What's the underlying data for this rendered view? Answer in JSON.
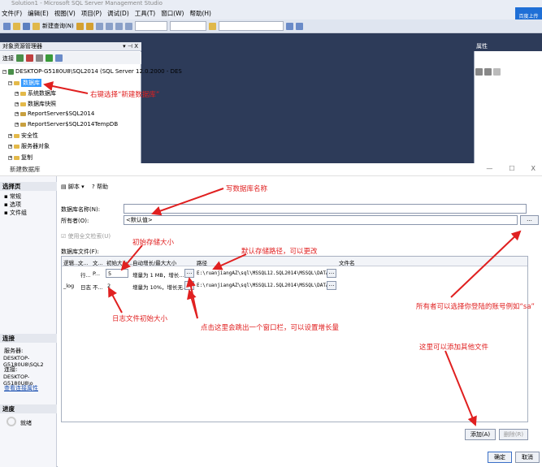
{
  "window": {
    "title": "Solution1 - Microsoft SQL Server Management Studio"
  },
  "menu": [
    "文件(F)",
    "编辑(E)",
    "视图(V)",
    "项目(P)",
    "调试(D)",
    "工具(T)",
    "窗口(W)",
    "帮助(H)"
  ],
  "toolbar": {
    "new_query": "新建查询(N)"
  },
  "cloud_button": "百度上传",
  "object_explorer": {
    "title": "对象资源管理器",
    "pin": "▾ ⊣ X",
    "connect": "连接",
    "server": "DESKTOP-G5180U8\\SQL2014 (SQL Server 12.0.2000 - DES",
    "databases": "数据库",
    "children": [
      "系统数据库",
      "数据库快照",
      "ReportServer$SQL2014",
      "ReportServer$SQL2014TempDB"
    ],
    "siblings": [
      "安全性",
      "服务器对象",
      "复制"
    ]
  },
  "properties_panel": {
    "title": "属性"
  },
  "dialog": {
    "title": "新建数据库",
    "minimize": "—",
    "maximize": "☐",
    "close": "X",
    "select_page_header": "选择页",
    "pages": [
      "常规",
      "选项",
      "文件组"
    ],
    "toolbar_script": "脚本 ▾",
    "toolbar_help": "帮助",
    "db_name_label": "数据库名称(N):",
    "db_name_value": "",
    "owner_label": "所有者(O):",
    "owner_value": "<默认值>",
    "owner_browse": "...",
    "fulltext_label": "使用全文检索(U)",
    "files_label": "数据库文件(F):",
    "columns": [
      "逻辑...",
      "文...",
      "文...",
      "初始大小...",
      "自动增长/最大大小",
      "路径",
      "文件名"
    ],
    "rows": [
      {
        "logical": "",
        "type": "行...",
        "filegroup": "P...",
        "size": "5",
        "growth": "增量为 1 MB，增长...",
        "path": "E:\\ruanjiangAZ\\sql\\MSSQL12.SQL2014\\MSSQL\\DATA\\",
        "filename": ""
      },
      {
        "logical": "_log",
        "type": "日志",
        "filegroup": "不...",
        "size": "2",
        "growth": "增量为 10%，增长无...",
        "path": "E:\\ruanjiangAZ\\sql\\MSSQL12.SQL2014\\MSSQL\\DATA\\",
        "filename": ""
      }
    ],
    "connection_header": "连接",
    "server_label": "服务器:",
    "server_value": "DESKTOP-G5180U8\\SQL2",
    "conn_label": "连接:",
    "conn_value": "DESKTOP-G5180U8\\o",
    "view_conn_props": "查看连接属性",
    "progress_header": "进度",
    "progress_status": "就绪",
    "add_button": "添加(A)",
    "remove_button": "删除(R)",
    "ok_button": "确定",
    "cancel_button": "取消"
  },
  "annotations": {
    "right_click": "右键选择“新建数据库”",
    "write_name": "写数据库名称",
    "initial_size": "初始存储大小",
    "default_path": "默认存储路径，可以更改",
    "log_size": "日志文件初始大小",
    "growth_click": "点击这里会跳出一个窗口栏，可以设置增长量",
    "owner_note": "所有者可以选择你登陆的账号例如“sa”",
    "add_files": "这里可以添加其他文件"
  },
  "colors": {
    "annotation": "#e02020",
    "selection": "#3399ff",
    "ide_background": "#2d3b59"
  }
}
